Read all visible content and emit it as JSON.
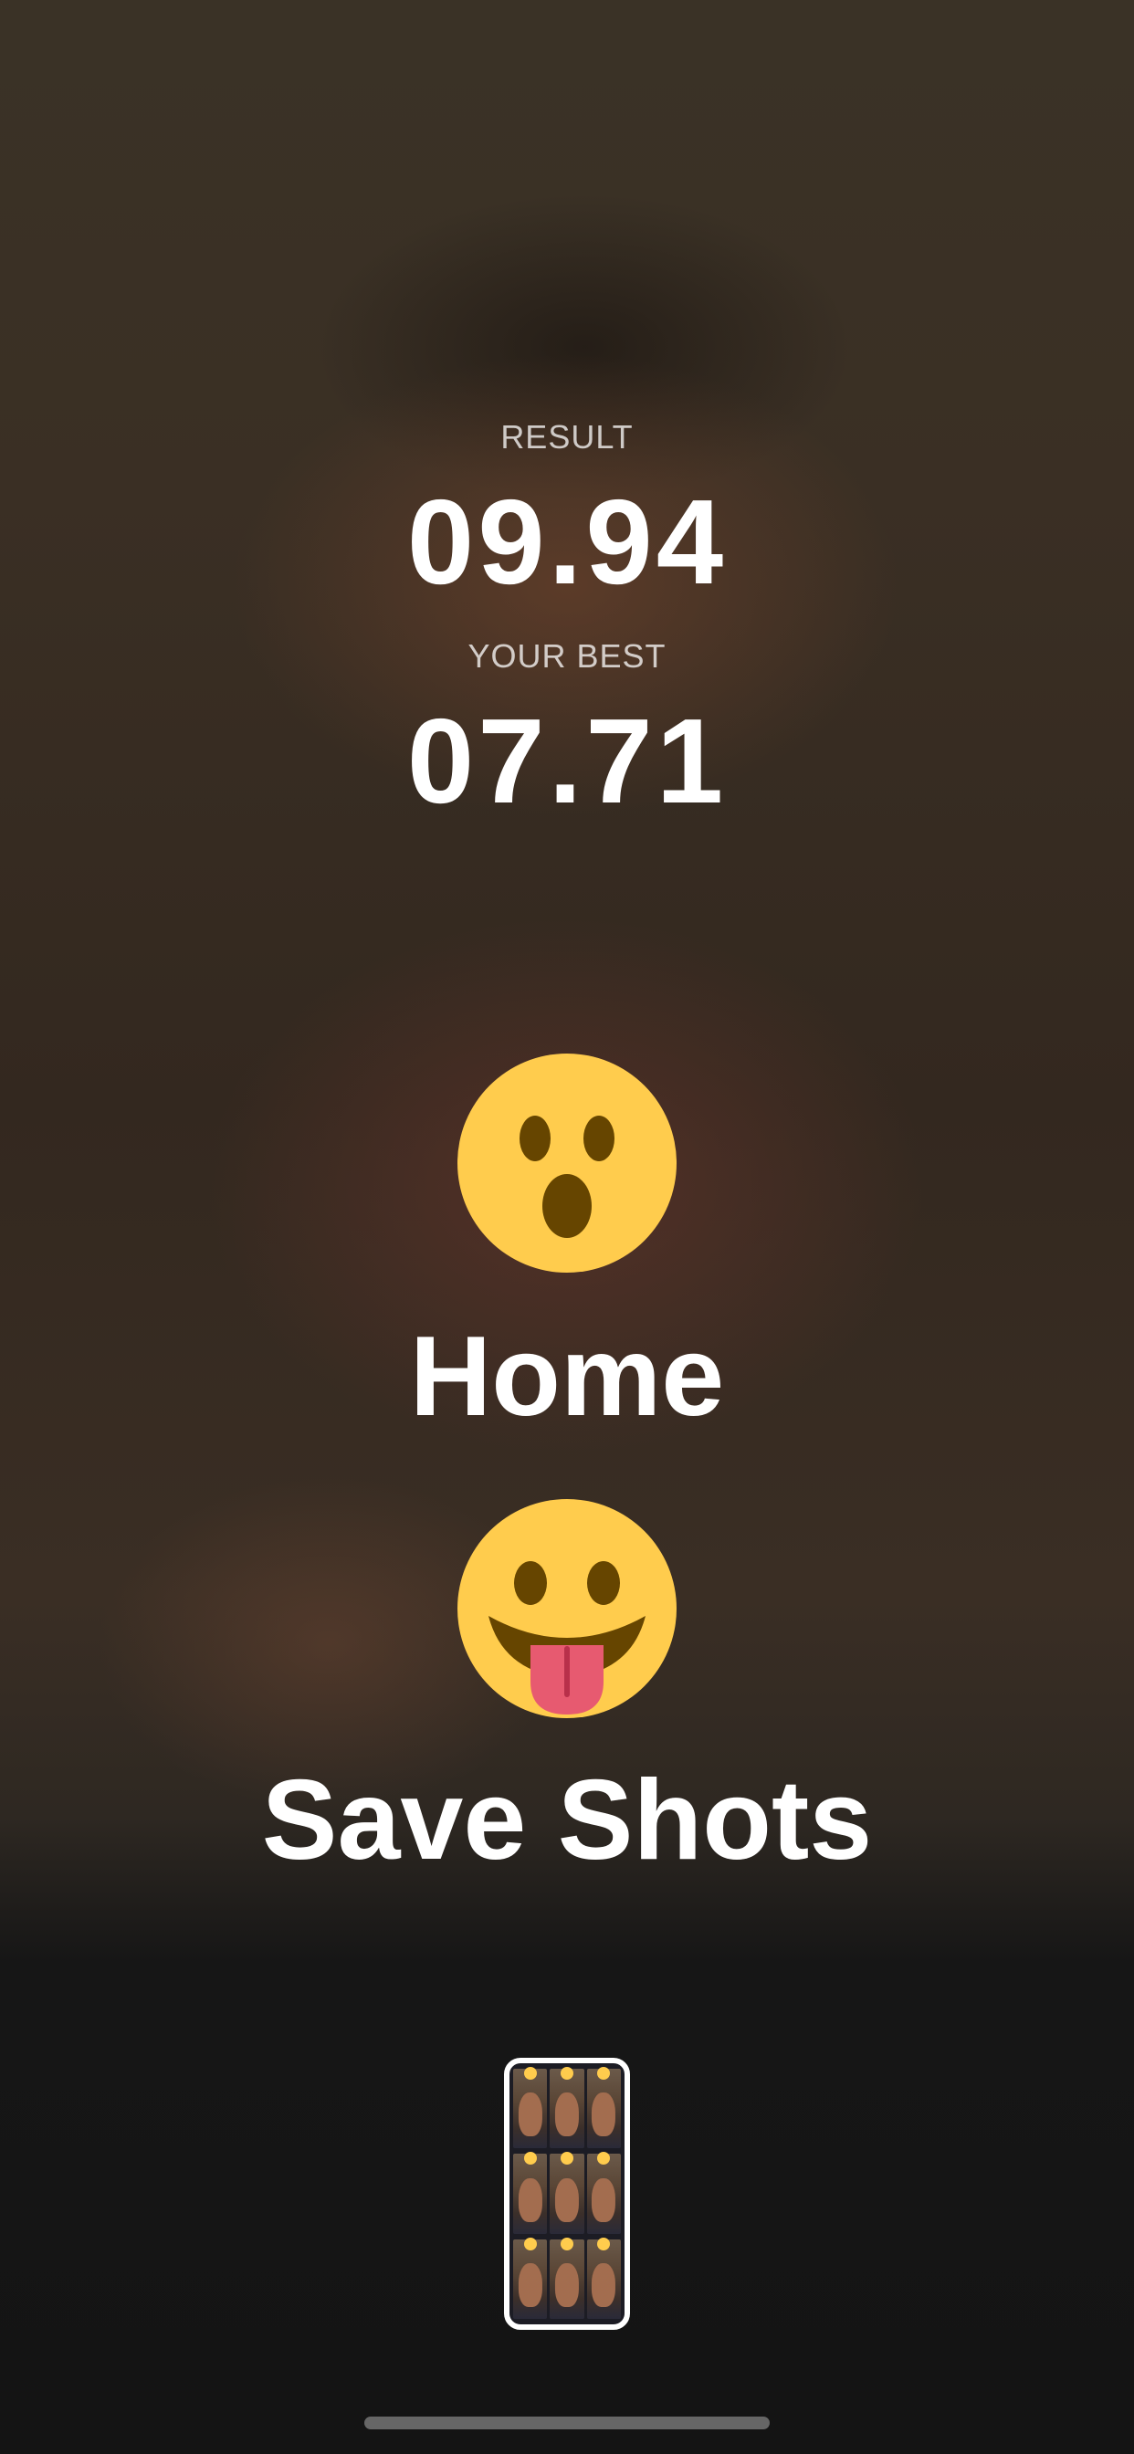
{
  "result": {
    "label": "RESULT",
    "value": "09.94"
  },
  "best": {
    "label": "YOUR BEST",
    "value": "07.71"
  },
  "actions": {
    "home": {
      "label": "Home",
      "icon": "surprised-face-emoji-icon"
    },
    "save": {
      "label": "Save Shots",
      "icon": "tongue-out-face-emoji-icon"
    }
  },
  "thumbnail": {
    "icon": "photo-grid-thumbnail-icon"
  },
  "colors": {
    "emoji_yellow": "#ffcc4d",
    "emoji_brown": "#664500",
    "tongue": "#e75a70",
    "text": "#ffffff"
  }
}
